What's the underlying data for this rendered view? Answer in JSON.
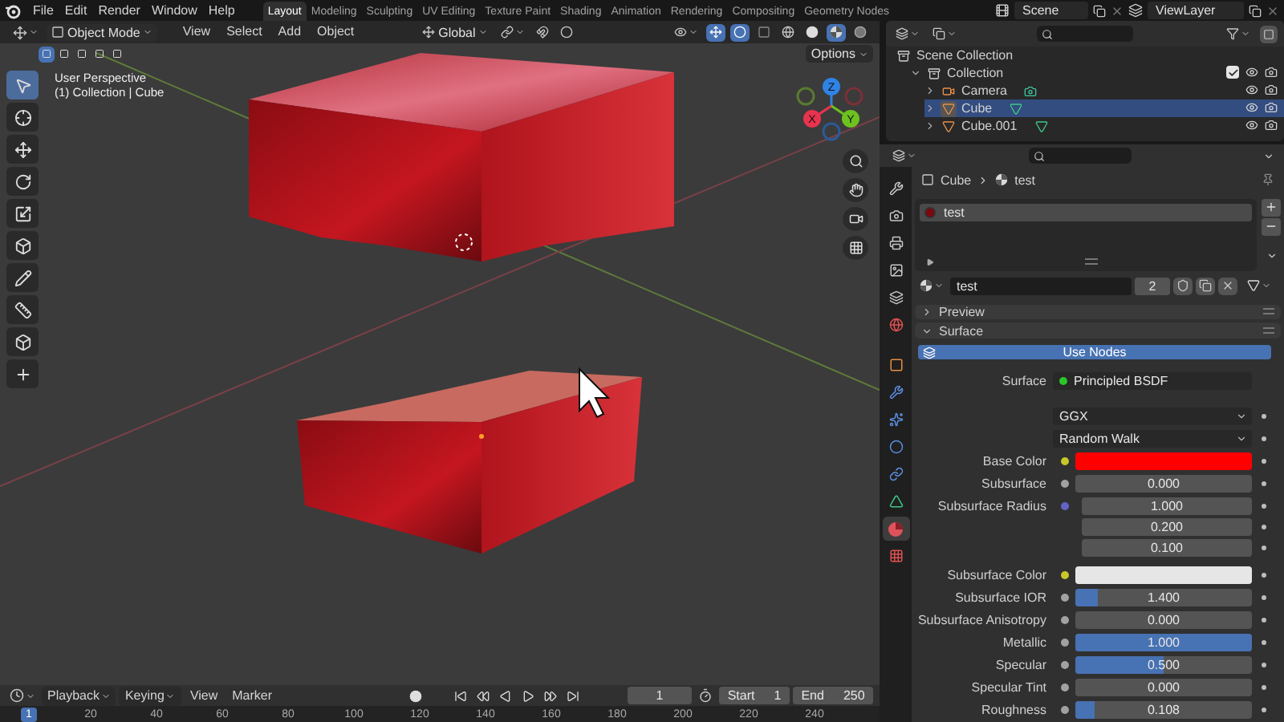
{
  "menu": [
    "File",
    "Edit",
    "Render",
    "Window",
    "Help"
  ],
  "workspaces": [
    {
      "label": "Layout",
      "selected": true
    },
    {
      "label": "Modeling",
      "selected": false
    },
    {
      "label": "Sculpting",
      "selected": false
    },
    {
      "label": "UV Editing",
      "selected": false
    },
    {
      "label": "Texture Paint",
      "selected": false
    },
    {
      "label": "Shading",
      "selected": false
    },
    {
      "label": "Animation",
      "selected": false
    },
    {
      "label": "Rendering",
      "selected": false
    },
    {
      "label": "Compositing",
      "selected": false
    },
    {
      "label": "Geometry Nodes",
      "selected": false
    }
  ],
  "scene": "Scene",
  "view_layer": "ViewLayer",
  "viewport": {
    "mode": "Object Mode",
    "menus": [
      "View",
      "Select",
      "Add",
      "Object"
    ],
    "orientation": "Global",
    "options": "Options",
    "info": [
      "User Perspective",
      "(1) Collection | Cube"
    ],
    "tools": [
      {
        "kind": "select",
        "selected": true
      },
      {
        "kind": "cursor",
        "selected": false
      },
      {
        "kind": "move",
        "selected": false
      },
      {
        "kind": "rotate",
        "selected": false
      },
      {
        "kind": "scale",
        "selected": false
      },
      {
        "kind": "transform",
        "selected": false
      },
      {
        "kind": "annotate",
        "selected": false
      },
      {
        "kind": "measure",
        "selected": false
      },
      {
        "kind": "add_cube",
        "selected": false
      },
      {
        "kind": "add",
        "selected": false
      }
    ],
    "gizmo": [
      {
        "label": "Z",
        "color": "#2f83e3"
      },
      {
        "label": "X",
        "color": "#e8334f"
      },
      {
        "label": "Y",
        "color": "#6ec21f"
      }
    ]
  },
  "outliner": {
    "tree": [
      {
        "kind": "scene_collection",
        "label": "Scene Collection",
        "selected": false,
        "children": [
          {
            "kind": "collection",
            "label": "Collection",
            "expanded": true,
            "checked": true,
            "selected": false,
            "children": [
              {
                "kind": "camera",
                "label": "Camera",
                "expanded": false,
                "selected": false
              },
              {
                "kind": "mesh",
                "label": "Cube",
                "expanded": false,
                "selected": true
              },
              {
                "kind": "mesh",
                "label": "Cube.001",
                "expanded": false,
                "selected": false
              }
            ]
          }
        ]
      }
    ]
  },
  "properties": {
    "tabs": [
      {
        "kind": "tool",
        "selected": false
      },
      {
        "kind": "render",
        "selected": false
      },
      {
        "kind": "output",
        "selected": false
      },
      {
        "kind": "view_layer",
        "selected": false
      },
      {
        "kind": "scene",
        "selected": false
      },
      {
        "kind": "world",
        "selected": false
      },
      {
        "kind": "object",
        "selected": false
      },
      {
        "kind": "modifiers",
        "selected": false
      },
      {
        "kind": "particles",
        "selected": false
      },
      {
        "kind": "physics",
        "selected": false
      },
      {
        "kind": "constraints",
        "selected": false
      },
      {
        "kind": "data",
        "selected": false
      },
      {
        "kind": "material",
        "selected": true
      },
      {
        "kind": "texture",
        "selected": false
      }
    ],
    "breadcrumb": [
      "Cube",
      "test"
    ],
    "slots": [
      {
        "label": "test",
        "selected": true
      }
    ],
    "material": {
      "name": "test",
      "users": "2"
    },
    "panels": [
      {
        "label": "Preview",
        "expanded": false
      },
      {
        "label": "Surface",
        "expanded": true
      }
    ],
    "use_nodes": "Use Nodes",
    "rows": [
      {
        "kind": "shader",
        "label": "Surface",
        "value": "Principled BSDF",
        "color": "#29c729"
      },
      {
        "kind": "dropdown",
        "value": "GGX"
      },
      {
        "kind": "dropdown",
        "value": "Random Walk"
      },
      {
        "kind": "swatch",
        "label": "Base Color",
        "color": "#c7c729",
        "swatch": {
          "color": "#ff0000"
        }
      },
      {
        "kind": "slider",
        "label": "Subsurface",
        "color": "#a1a1a1",
        "value": "0.000",
        "level": 0
      },
      {
        "kind": "vector",
        "label": "Subsurface Radius",
        "color": "#6363c7",
        "values": [
          "1.000",
          "0.200",
          "0.100"
        ]
      },
      {
        "kind": "swatch",
        "label": "Subsurface Color",
        "color": "#c7c729",
        "swatch": {
          "color": "#e6e6e6"
        }
      },
      {
        "kind": "slider",
        "label": "Subsurface IOR",
        "color": "#a1a1a1",
        "value": "1.400",
        "level": 0.13
      },
      {
        "kind": "slider",
        "label": "Subsurface Anisotropy",
        "color": "#a1a1a1",
        "value": "0.000",
        "level": 0
      },
      {
        "kind": "slider",
        "label": "Metallic",
        "color": "#a1a1a1",
        "value": "1.000",
        "level": 1
      },
      {
        "kind": "slider",
        "label": "Specular",
        "color": "#a1a1a1",
        "value": "0.500",
        "level": 0.5
      },
      {
        "kind": "slider",
        "label": "Specular Tint",
        "color": "#a1a1a1",
        "value": "0.000",
        "level": 0
      },
      {
        "kind": "slider",
        "label": "Roughness",
        "color": "#a1a1a1",
        "value": "0.108",
        "level": 0.108
      }
    ]
  },
  "timeline": {
    "menus": [
      {
        "label": "Playback",
        "kind": "dropdown"
      },
      {
        "label": "Keying",
        "kind": "dropdown"
      },
      {
        "label": "View",
        "kind": "plain"
      },
      {
        "label": "Marker",
        "kind": "plain"
      }
    ],
    "frame": "1",
    "start": {
      "label": "Start",
      "value": "1"
    },
    "end": {
      "label": "End",
      "value": "250"
    },
    "ruler": [
      {
        "label": "1",
        "selected": true
      },
      {
        "label": "20",
        "selected": false
      },
      {
        "label": "40",
        "selected": false
      },
      {
        "label": "60",
        "selected": false
      },
      {
        "label": "80",
        "selected": false
      },
      {
        "label": "100",
        "selected": false
      },
      {
        "label": "120",
        "selected": false
      },
      {
        "label": "140",
        "selected": false
      },
      {
        "label": "160",
        "selected": false
      },
      {
        "label": "180",
        "selected": false
      },
      {
        "label": "200",
        "selected": false
      },
      {
        "label": "220",
        "selected": false
      },
      {
        "label": "240",
        "selected": false
      }
    ]
  }
}
